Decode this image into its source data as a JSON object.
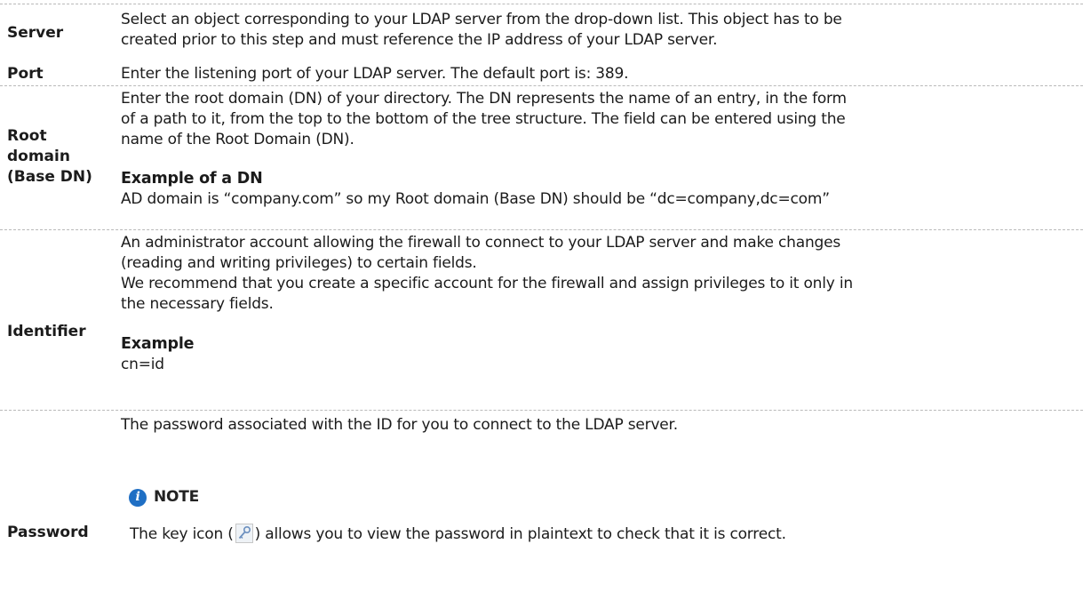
{
  "rows": {
    "server": {
      "label": "Server",
      "desc_1": "Select an object corresponding to your LDAP server from the drop-down list. This object has to be",
      "desc_2": "created prior to this step and must reference the IP address of your LDAP server."
    },
    "port": {
      "label": "Port",
      "desc": "Enter the listening port of your LDAP server. The default port is: 389."
    },
    "root": {
      "label_1": "Root",
      "label_2": "domain",
      "label_3": "(Base DN)",
      "desc_1": "Enter the root domain (DN) of your directory. The DN represents the name of an entry, in the form",
      "desc_2": "of a path to it, from the top to the bottom of the tree structure. The field can be entered using the",
      "desc_3": "name of the Root Domain (DN).",
      "example_title": "Example of a DN",
      "example_text": "AD domain is “company.com” so my Root domain (Base DN) should be “dc=company,dc=com”"
    },
    "identifier": {
      "label": "Identifier",
      "desc_1": "An administrator account allowing the firewall to connect to your LDAP server and make changes",
      "desc_2": "(reading and writing privileges) to certain fields.",
      "desc_3": "We recommend that you create a specific account for the firewall and assign privileges to it only in",
      "desc_4": "the necessary fields.",
      "example_title": "Example",
      "example_text": "cn=id"
    },
    "password": {
      "label": "Password",
      "desc": "The password associated with the ID for you to connect to the LDAP server.",
      "note_title": "NOTE",
      "note_before": "The key icon (",
      "note_after": ") allows you to view the password in plaintext to check that it is correct."
    }
  },
  "icons": {
    "info": "info-icon",
    "key": "key-icon",
    "info_color": "#1f6fc4"
  }
}
